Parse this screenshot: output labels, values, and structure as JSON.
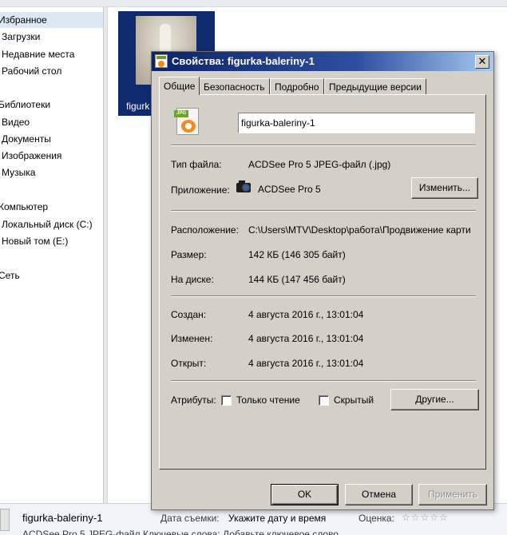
{
  "explorer": {
    "nav": {
      "favorites": "Избранное",
      "downloads": "Загрузки",
      "recent_places": "Недавние места",
      "desktop": "Рабочий стол",
      "libraries": "Библиотеки",
      "video": "Видео",
      "documents": "Документы",
      "images": "Изображения",
      "music": "Музыка",
      "computer": "Компьютер",
      "local_disk": "Локальный диск (C:)",
      "new_volume": "Новый том (E:)",
      "network": "Сеть"
    },
    "thumbnail_name": "figurk",
    "details": {
      "file_name": "figurka-baleriny-1",
      "date_taken_label": "Дата съемки:",
      "date_taken_value": "Укажите дату и время",
      "rating_label": "Оценка:",
      "stars": "☆☆☆☆☆",
      "line2": "ACDSee Pro 5 JPEG-файл   Ключевые слова:  Добавьте ключевое слово"
    }
  },
  "dialog": {
    "title": "Свойства: figurka-baleriny-1",
    "close_glyph": "✕",
    "tabs": [
      "Общие",
      "Безопасность",
      "Подробно",
      "Предыдущие версии"
    ],
    "file_icon_badge": "JPG",
    "file_name_value": "figurka-baleriny-1",
    "file_type_label": "Тип файла:",
    "file_type_value": "ACDSee Pro 5 JPEG-файл (.jpg)",
    "app_label": "Приложение:",
    "app_value": "ACDSee Pro 5",
    "change_button": "Изменить...",
    "location_label": "Расположение:",
    "location_value": "C:\\Users\\MTV\\Desktop\\работа\\Продвижение карти",
    "size_label": "Размер:",
    "size_value": "142 КБ (146 305 байт)",
    "disk_label": "На диске:",
    "disk_value": "144 КБ (147 456 байт)",
    "created_label": "Создан:",
    "created_value": "4 августа 2016 г., 13:01:04",
    "modified_label": "Изменен:",
    "modified_value": "4 августа 2016 г., 13:01:04",
    "opened_label": "Открыт:",
    "opened_value": "4 августа 2016 г., 13:01:04",
    "attributes_label": "Атрибуты:",
    "readonly_label": "Только чтение",
    "hidden_label": "Скрытый",
    "other_button": "Другие...",
    "ok_button": "OK",
    "cancel_button": "Отмена",
    "apply_button": "Применить"
  }
}
